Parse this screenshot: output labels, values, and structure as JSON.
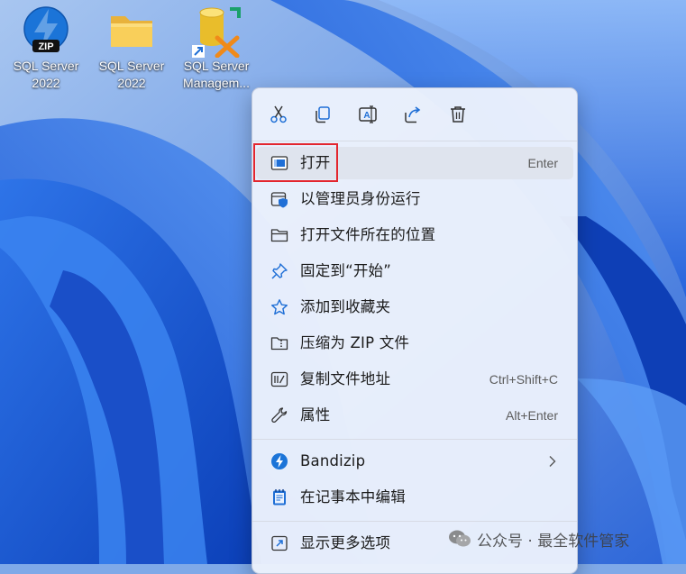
{
  "desktop": {
    "icons": [
      {
        "name": "SQL Server 2022 (Bandizip archive)",
        "line1": "SQL Server",
        "line2": "2022",
        "icon": "zip-archive-icon"
      },
      {
        "name": "SQL Server 2022 folder",
        "line1": "SQL Server",
        "line2": "2022",
        "icon": "folder-icon"
      },
      {
        "name": "SQL Server Management shortcut",
        "line1": "SQL Server",
        "line2": "Managem...",
        "icon": "database-tools-icon"
      }
    ]
  },
  "context_menu": {
    "quick_actions": [
      {
        "label": "cut",
        "icon": "scissors-icon"
      },
      {
        "label": "copy",
        "icon": "copy-icon"
      },
      {
        "label": "rename",
        "icon": "rename-icon"
      },
      {
        "label": "share",
        "icon": "share-icon"
      },
      {
        "label": "delete",
        "icon": "trash-icon"
      }
    ],
    "items": [
      {
        "label": "打开",
        "shortcut": "Enter",
        "icon": "open-window-icon",
        "hovered": true
      },
      {
        "label": "以管理员身份运行",
        "shortcut": "",
        "icon": "admin-shield-icon"
      },
      {
        "label": "打开文件所在的位置",
        "shortcut": "",
        "icon": "folder-outline-icon"
      },
      {
        "label": "固定到“开始”",
        "shortcut": "",
        "icon": "pin-icon"
      },
      {
        "label": "添加到收藏夹",
        "shortcut": "",
        "icon": "star-icon"
      },
      {
        "label": "压缩为 ZIP 文件",
        "shortcut": "",
        "icon": "zip-folder-icon"
      },
      {
        "label": "复制文件地址",
        "shortcut": "Ctrl+Shift+C",
        "icon": "copy-path-icon"
      },
      {
        "label": "属性",
        "shortcut": "Alt+Enter",
        "icon": "wrench-icon"
      },
      {
        "label": "Bandizip",
        "shortcut": "",
        "icon": "bandizip-icon",
        "submenu": true
      },
      {
        "label": "在记事本中编辑",
        "shortcut": "",
        "icon": "notepad-icon"
      },
      {
        "label": "显示更多选项",
        "shortcut": "",
        "icon": "show-more-icon"
      }
    ]
  },
  "watermark": {
    "text": "公众号 · 最全软件管家",
    "icon": "wechat-icon"
  },
  "colors": {
    "highlight_border": "#e3262e",
    "accent_blue": "#1f6fd6",
    "menu_bg": "#ecf1fc"
  }
}
